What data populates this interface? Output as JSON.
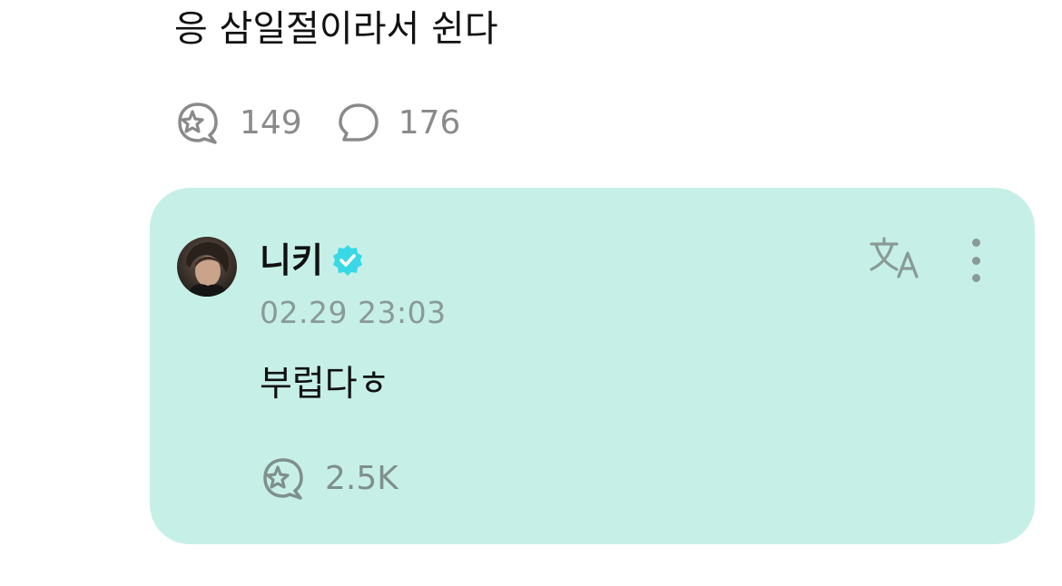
{
  "post": {
    "text": "응 삼일절이라서 쉰다",
    "likes": "149",
    "comments": "176"
  },
  "comment": {
    "author": "니키",
    "verified": true,
    "timestamp": "02.29 23:03",
    "text": "부럽다ㅎ",
    "likes": "2.5K"
  },
  "icons": {
    "like": "sparkle-bubble-icon",
    "comment": "speech-bubble-icon",
    "verified": "verified-badge-icon",
    "translate": "translate-icon",
    "more": "more-vertical-icon"
  },
  "colors": {
    "card_bg": "#c6f0e7",
    "verified": "#3ad8e6",
    "muted": "#8a8a8a"
  }
}
